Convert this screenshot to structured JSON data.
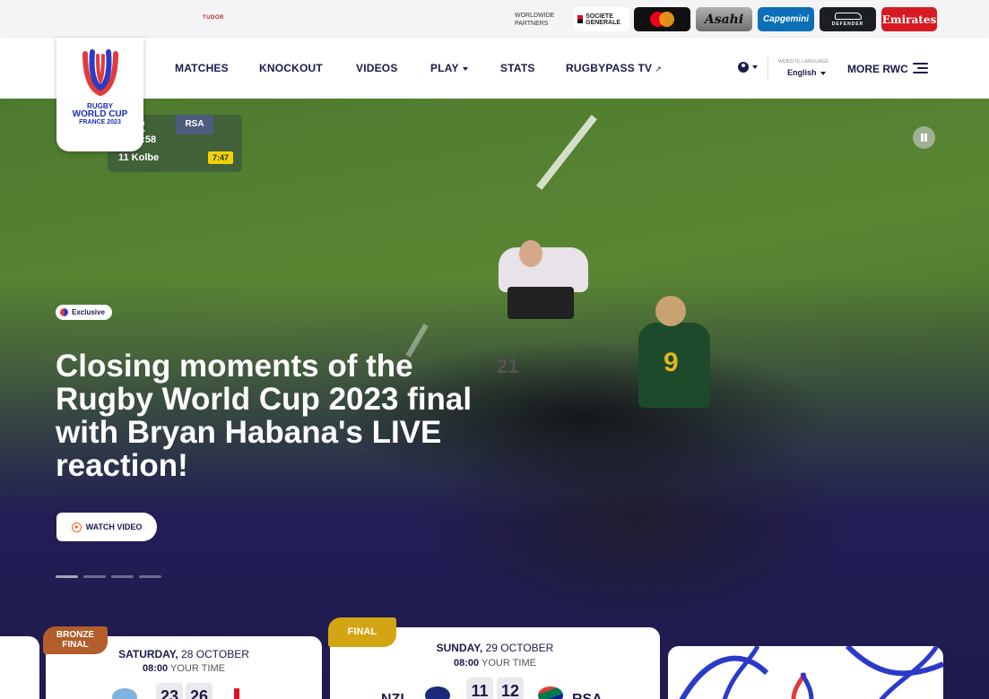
{
  "partners": {
    "tudor": "TUDOR",
    "worldwide_label": "WORLDWIDE PARTNERS",
    "sponsors": [
      "SOCIETE GENERALE",
      "mastercard",
      "Asahi",
      "Capgemini",
      "DEFENDER",
      "Emirates"
    ]
  },
  "logo": {
    "line1": "RUGBY",
    "line2": "WORLD CUP",
    "line3": "FRANCE 2023"
  },
  "nav": {
    "items": [
      "MATCHES",
      "KNOCKOUT",
      "VIDEOS",
      "PLAY",
      "STATS",
      "RUGBYPASS TV"
    ],
    "language_label": "WEBSITE LANGUAGE",
    "language": "English",
    "more": "MORE RWC"
  },
  "hero": {
    "scorebug": {
      "score": "12",
      "team": "RSA",
      "time": "14:58",
      "player": "11 Kolbe",
      "clock": "7:47"
    },
    "badge": "Exclusive",
    "headline": "Closing moments of the Rugby World Cup 2023 final with Bryan Habana's LIVE reaction!",
    "cta": "WATCH VIDEO",
    "jersey_sa": "9",
    "jersey_nz": "21"
  },
  "matches": [
    {
      "tag": "BRONZE FINAL",
      "day": "SATURDAY,",
      "date": "28 OCTOBER",
      "time": "08:00",
      "time_label": "YOUR TIME",
      "score_home": "23",
      "score_away": "26"
    },
    {
      "tag": "FINAL",
      "day": "SUNDAY,",
      "date": "29 OCTOBER",
      "time": "08:00",
      "time_label": "YOUR TIME",
      "score_home": "11",
      "score_away": "12",
      "home": "NZL",
      "away": "RSA"
    }
  ],
  "colors": {
    "brand_navy": "#1c1a4a",
    "hero_bg": "#1f1b4d",
    "bronze": "#b25d2a",
    "final_gold": "#d4a513",
    "cta_accent": "#ff5a1f"
  }
}
